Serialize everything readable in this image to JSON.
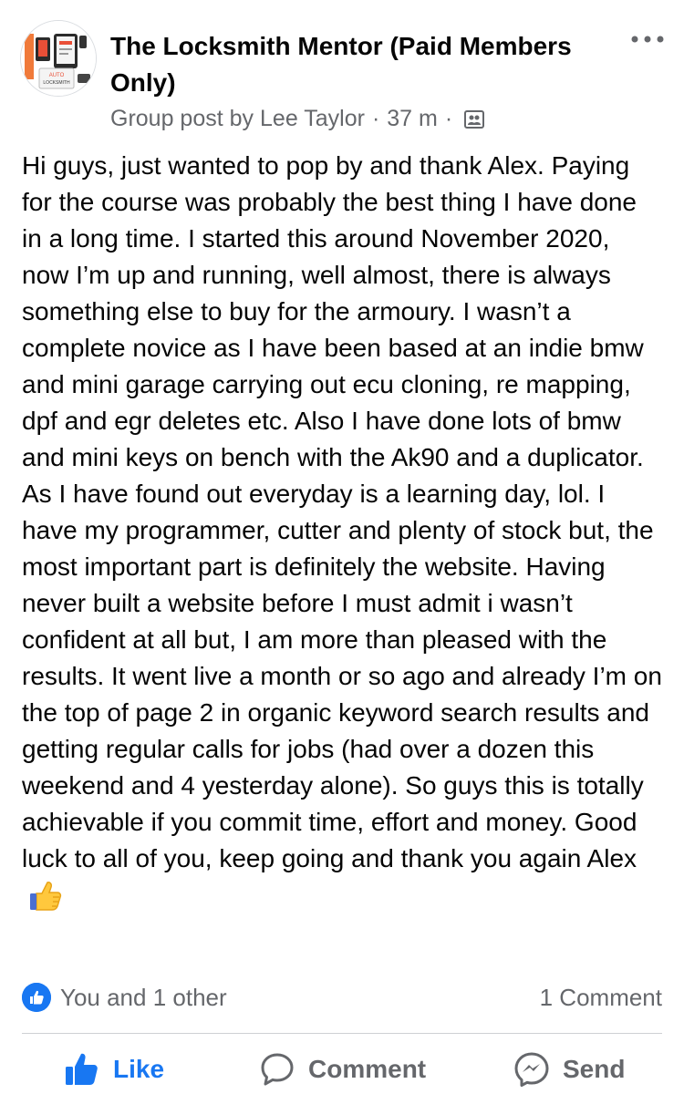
{
  "post": {
    "group_name": "The Locksmith Mentor (Paid Members Only)",
    "post_type": "Group post by",
    "author": "Lee Taylor",
    "time_ago": "37 m",
    "separator": "·",
    "body": "Hi guys, just wanted to pop by and thank Alex. Paying for the course was probably the best thing I have done in a long time. I started this around November 2020, now I’m up and running, well almost, there is always something else to buy for the armoury. I wasn’t a complete novice as I have been based at an indie bmw and mini garage carrying out ecu cloning, re mapping, dpf and egr deletes etc. Also I have done lots of bmw and mini keys on bench with the Ak90 and a duplicator. As I have found out everyday is a learning day, lol. I have my programmer, cutter and plenty of stock but, the most important part is definitely the website. Having never built a website before I must admit i wasn’t confident at all but, I am more than pleased with the results. It went live a month or so ago and already I’m on the top of page 2 in organic keyword search results and getting regular calls for jobs (had over a dozen this weekend and 4 yesterday alone). So guys this is totally achievable if you commit time, effort and money. Good luck to all of you, keep going and thank you again Alex",
    "body_emoji_icon": "thumbs-up-emoji"
  },
  "avatar_logo_text": [
    "AUTO",
    "LOCKSMITH"
  ],
  "reactions": {
    "summary": "You and 1 other",
    "reaction_icon": "like-icon",
    "comments_count": "1 Comment"
  },
  "actions": {
    "like_label": "Like",
    "comment_label": "Comment",
    "send_label": "Send"
  },
  "colors": {
    "brand_blue": "#1877f2",
    "secondary_text": "#65676b",
    "primary_text": "#050505",
    "divider": "#ced0d4"
  }
}
